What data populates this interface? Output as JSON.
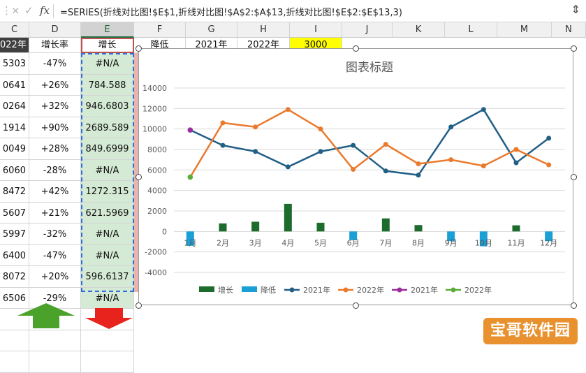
{
  "formula_bar": {
    "cancel_icon": "×",
    "confirm_icon": "✓",
    "fx_icon": "fx",
    "formula": "=SERIES(折线对比图!$E$1,折线对比图!$A$2:$A$13,折线对比图!$E$2:$E$13,3)"
  },
  "columns": [
    "C",
    "D",
    "E",
    "F",
    "G",
    "H",
    "I",
    "J",
    "K",
    "L",
    "M",
    "N"
  ],
  "header_row": {
    "c": "022年",
    "d": "增长率",
    "e": "增长",
    "f": "降低",
    "g": "2021年",
    "h": "2022年",
    "i": "3000"
  },
  "rows": [
    {
      "c": "5303",
      "d": "-47%",
      "e": "#N/A"
    },
    {
      "c": "0641",
      "d": "+26%",
      "e": "784.588"
    },
    {
      "c": "0264",
      "d": "+32%",
      "e": "946.6803"
    },
    {
      "c": "1914",
      "d": "+90%",
      "e": "2689.589"
    },
    {
      "c": "0049",
      "d": "+28%",
      "e": "849.6999"
    },
    {
      "c": "6060",
      "d": "-28%",
      "e": "#N/A"
    },
    {
      "c": "8472",
      "d": "+42%",
      "e": "1272.315"
    },
    {
      "c": "5607",
      "d": "+21%",
      "e": "621.5969"
    },
    {
      "c": "5997",
      "d": "-32%",
      "e": "#N/A"
    },
    {
      "c": "6400",
      "d": "-47%",
      "e": "#N/A"
    },
    {
      "c": "8072",
      "d": "+20%",
      "e": "596.6137"
    },
    {
      "c": "6506",
      "d": "-29%",
      "e": "#N/A"
    }
  ],
  "chart_data": {
    "type": "bar",
    "title": "图表标题",
    "xlabel": "",
    "ylabel": "",
    "ylim": [
      -4000,
      14000
    ],
    "yticks": [
      -4000,
      -2000,
      0,
      2000,
      4000,
      6000,
      8000,
      10000,
      12000,
      14000
    ],
    "categories": [
      "1月",
      "2月",
      "3月",
      "4月",
      "5月",
      "6月",
      "7月",
      "8月",
      "9月",
      "10月",
      "11月",
      "12月"
    ],
    "grid": true,
    "legend_position": "bottom",
    "series": [
      {
        "name": "增长",
        "kind": "bar",
        "color": "#1e6b2e",
        "values": [
          null,
          785,
          947,
          2690,
          850,
          null,
          1272,
          622,
          null,
          null,
          597,
          null
        ]
      },
      {
        "name": "降低",
        "kind": "bar",
        "color": "#1a9fd6",
        "values": [
          -1400,
          null,
          null,
          null,
          null,
          -850,
          null,
          null,
          -950,
          -1450,
          null,
          -950
        ]
      },
      {
        "name": "2021年",
        "kind": "line",
        "color": "#215f86",
        "values": [
          9900,
          8400,
          7800,
          6300,
          7800,
          8400,
          5900,
          5500,
          10200,
          11900,
          6700,
          9100
        ]
      },
      {
        "name": "2022年",
        "kind": "line",
        "color": "#ea7a2c",
        "values": [
          5300,
          10600,
          10200,
          11900,
          10000,
          6060,
          8500,
          6600,
          7000,
          6400,
          8000,
          6500
        ]
      },
      {
        "name": "2021年",
        "kind": "point",
        "color": "#9b2ca0",
        "values": [
          9900,
          null,
          null,
          null,
          null,
          null,
          null,
          null,
          null,
          null,
          null,
          null
        ]
      },
      {
        "name": "2022年",
        "kind": "point",
        "color": "#5aad3a",
        "values": [
          5300,
          null,
          null,
          null,
          null,
          null,
          null,
          null,
          null,
          null,
          null,
          null
        ]
      }
    ]
  },
  "watermark": "宝哥软件园",
  "colors": {
    "up_arrow": "#4aa22a",
    "down_arrow": "#e8221c"
  }
}
